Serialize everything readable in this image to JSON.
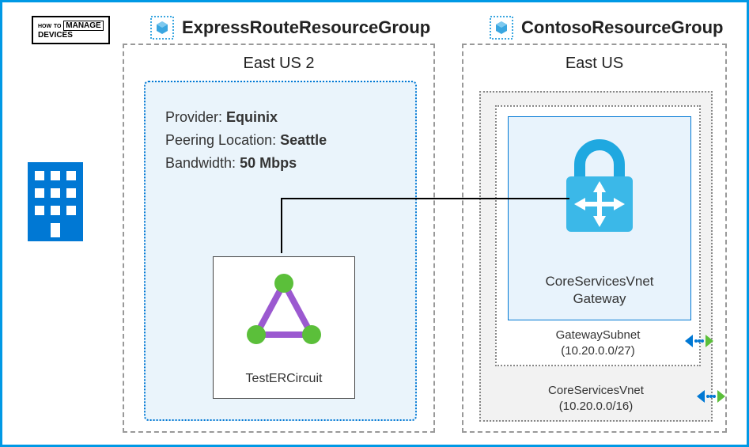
{
  "logo": {
    "line1": "HOW",
    "line2": "TO",
    "line3": "MANAGE",
    "line4": "DEVICES"
  },
  "left_rg": {
    "title": "ExpressRouteResourceGroup",
    "region": "East US 2",
    "provider_label": "Provider:",
    "provider_value": "Equinix",
    "peering_label": "Peering Location:",
    "peering_value": "Seattle",
    "bandwidth_label": "Bandwidth:",
    "bandwidth_value": "50 Mbps",
    "circuit_name": "TestERCircuit"
  },
  "right_rg": {
    "title": "ContosoResourceGroup",
    "region": "East US",
    "gateway_name_line1": "CoreServicesVnet",
    "gateway_name_line2": "Gateway",
    "subnet_name": "GatewaySubnet",
    "subnet_cidr": "(10.20.0.0/27)",
    "vnet_name": "CoreServicesVnet",
    "vnet_cidr": "(10.20.0.0/16)"
  }
}
